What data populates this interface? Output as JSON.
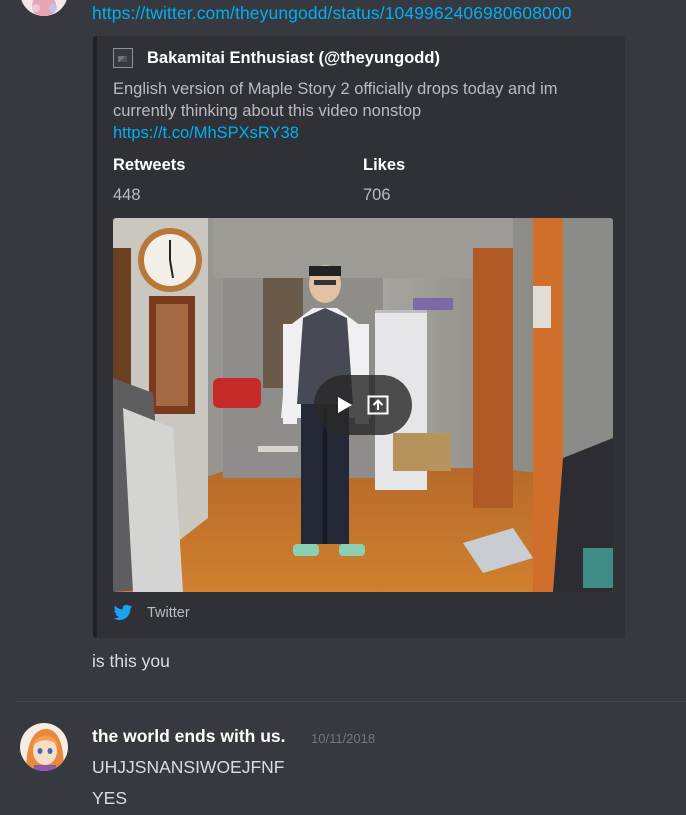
{
  "previous_message": {
    "link": "https://twitter.com/theyungodd/status/1049962406980608000"
  },
  "embed": {
    "author": "Bakamitai Enthusiast (@theyungodd)",
    "description": "English version of Maple Story 2 officially drops today and im currently thinking about this video nonstop",
    "description_link": "https://t.co/MhSPXsRY38",
    "fields": [
      {
        "name": "Retweets",
        "value": "448"
      },
      {
        "name": "Likes",
        "value": "706"
      }
    ],
    "footer": "Twitter"
  },
  "message_text": "is this you",
  "next_message": {
    "username": "the world ends with us.",
    "timestamp": "10/11/2018",
    "lines": [
      "UHJJSNANSIWOEJFNF",
      "YES"
    ]
  },
  "colors": {
    "background": "#36393f",
    "embed_background": "#2f3136",
    "link": "#00b0f4",
    "twitter_blue": "#1da1f2"
  },
  "icons": {
    "video_play": "play-icon",
    "video_open": "open-external-icon",
    "footer": "twitter-bird-icon",
    "author": "broken-image-icon"
  }
}
